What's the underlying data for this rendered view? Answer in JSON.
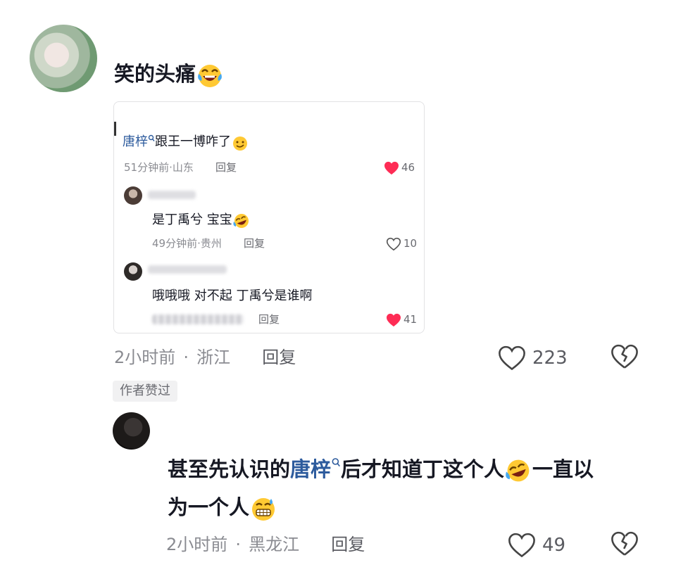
{
  "comment1": {
    "text": "笑的头痛",
    "emoji": "laughing-tears-emoji",
    "time": "2小时前",
    "location": "浙江",
    "reply_label": "回复",
    "like_count": "223",
    "author_liked_badge": "作者赞过"
  },
  "quoted": {
    "top": {
      "name": "唐梓",
      "text": "跟王一博咋了",
      "emoji": "smirk-emoji",
      "time": "51分钟前",
      "location": "山东",
      "reply_label": "回复",
      "like_count": "46",
      "liked": true
    },
    "reply1": {
      "text": "是丁禹兮  宝宝",
      "emoji": "rofl-emoji",
      "time": "49分钟前",
      "location": "贵州",
      "reply_label": "回复",
      "like_count": "10",
      "liked": false
    },
    "reply2": {
      "text": "哦哦哦 对不起 丁禹兮是谁啊",
      "reply_label": "回复",
      "like_count": "41",
      "liked": true
    }
  },
  "comment2": {
    "text_before": "甚至先认识的",
    "mention": "唐梓",
    "text_after": "后才知道丁这个人",
    "text_after_emoji": "一直以",
    "line2": "为一个人",
    "time": "2小时前",
    "location": "黑龙江",
    "reply_label": "回复",
    "like_count": "49"
  },
  "separator": "·",
  "colors": {
    "mention": "#2d5b9d",
    "like_red": "#fe2c55",
    "meta_gray": "#8a8b91"
  }
}
